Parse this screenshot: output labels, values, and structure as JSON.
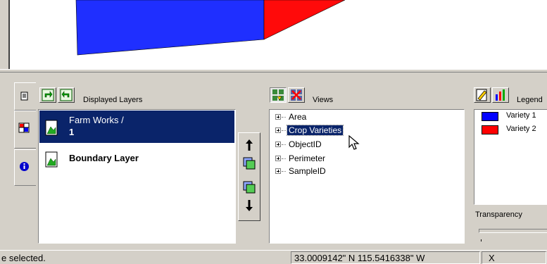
{
  "colors": {
    "blue_area": "#1f2fff",
    "red_area": "#ff0a0a",
    "selection": "#0a246a"
  },
  "layers_panel": {
    "title": "Displayed Layers",
    "layers": [
      {
        "name": "Farm Works /",
        "sub": "1",
        "selected": true
      },
      {
        "name": "Boundary Layer",
        "selected": false
      }
    ]
  },
  "views_panel": {
    "title": "Views",
    "items": [
      "Area",
      "Crop Varieties",
      "ObjectID",
      "Perimeter",
      "SampleID"
    ],
    "selected_index": 1
  },
  "legend_panel": {
    "title": "Legend",
    "items": [
      {
        "label": "Variety 1",
        "color": "#0000ff"
      },
      {
        "label": "Variety 2",
        "color": "#ff0000"
      }
    ],
    "transparency_label": "Transparency"
  },
  "status_bar": {
    "message": "e selected.",
    "coordinates": "33.0009142\" N  115.5416338\" W",
    "x_label": "X"
  },
  "icons": [
    "layers-tab-icon",
    "map-tab-icon",
    "info-tab-icon",
    "move-up-icon",
    "move-down-icon",
    "layer-add-icon",
    "layer-remove-icon",
    "view-add-icon",
    "view-remove-icon",
    "legend-edit-icon",
    "legend-chart-icon",
    "pointer-cursor-icon"
  ]
}
